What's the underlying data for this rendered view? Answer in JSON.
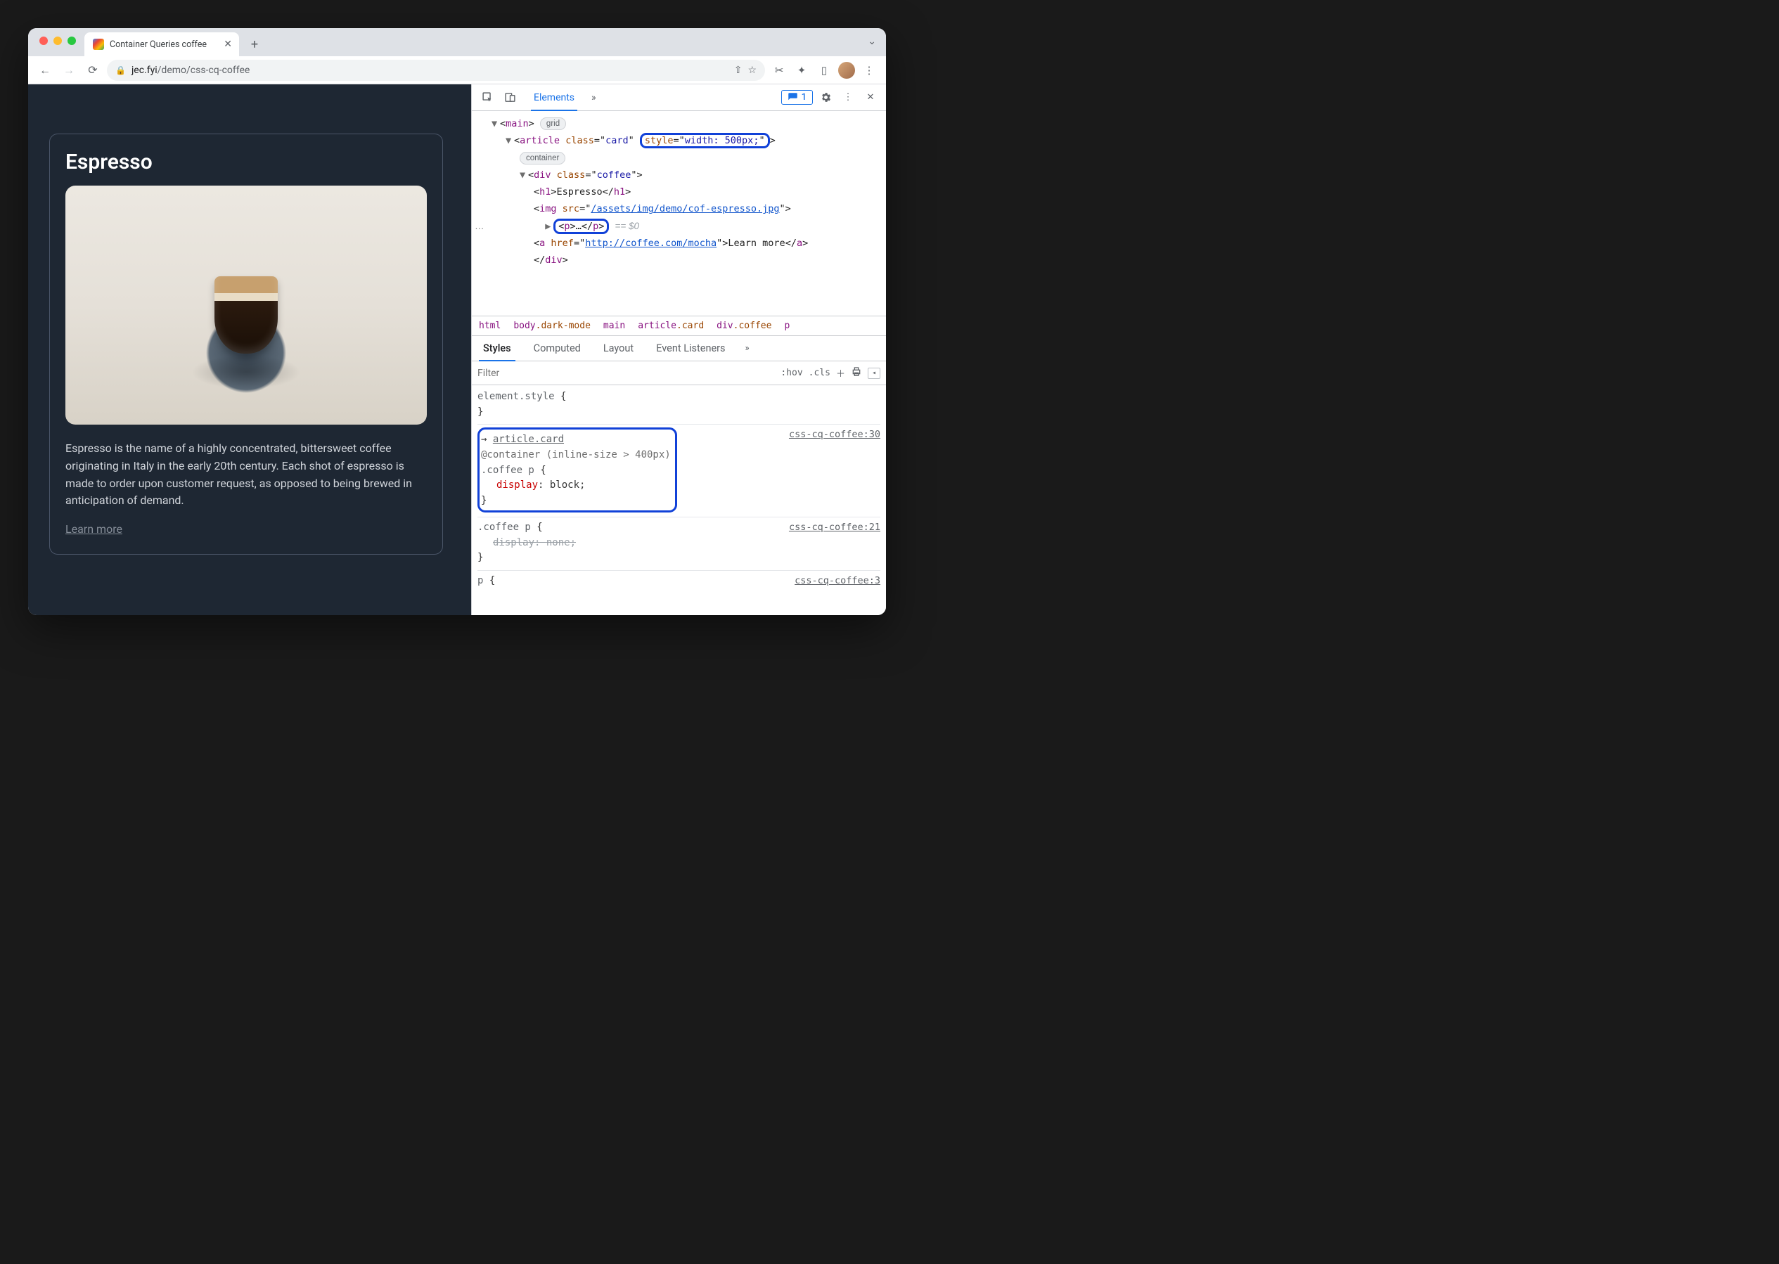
{
  "tab": {
    "title": "Container Queries coffee"
  },
  "url": {
    "host": "jec.fyi",
    "path": "/demo/css-cq-coffee"
  },
  "issues": {
    "count": "1"
  },
  "devtools_tabs": {
    "elements": "Elements"
  },
  "page": {
    "title": "Espresso",
    "body": "Espresso is the name of a highly concentrated, bittersweet coffee originating in Italy in the early 20th century. Each shot of espresso is made to order upon customer request, as opposed to being brewed in anticipation of demand.",
    "link": "Learn more"
  },
  "dom": {
    "main": "main",
    "grid_pill": "grid",
    "article": "article",
    "class": "class",
    "card": "card",
    "style_attr": "style",
    "style_val": "width: 500px;",
    "container_pill": "container",
    "div": "div",
    "coffee": "coffee",
    "h1": "h1",
    "h1_text": "Espresso",
    "img": "img",
    "src": "src",
    "img_path": "/assets/img/demo/cof-espresso.jpg",
    "p": "p",
    "p_ellipsis": "…",
    "eq0": "== $0",
    "a": "a",
    "href": "href",
    "a_url": "http://coffee.com/mocha",
    "a_text": "Learn more"
  },
  "crumbs": {
    "html": "html",
    "body": "body",
    "body_cls": ".dark-mode",
    "main": "main",
    "article": "article",
    "article_cls": ".card",
    "div": "div",
    "div_cls": ".coffee",
    "p": "p"
  },
  "sp": {
    "styles": "Styles",
    "computed": "Computed",
    "layout": "Layout",
    "events": "Event Listeners",
    "filter_ph": "Filter",
    "hov": ":hov",
    "cls": ".cls"
  },
  "rules": {
    "elstyle": "element.style",
    "inherited_from": "article.card",
    "cq": "@container (inline-size > 400px)",
    "sel_coffee_p": ".coffee p",
    "display": "display",
    "block": "block",
    "none_val": "none",
    "p_sel": "p",
    "src30": "css-cq-coffee:30",
    "src21": "css-cq-coffee:21",
    "src3": "css-cq-coffee:3",
    "brace_open": "{",
    "brace_close": "}"
  }
}
